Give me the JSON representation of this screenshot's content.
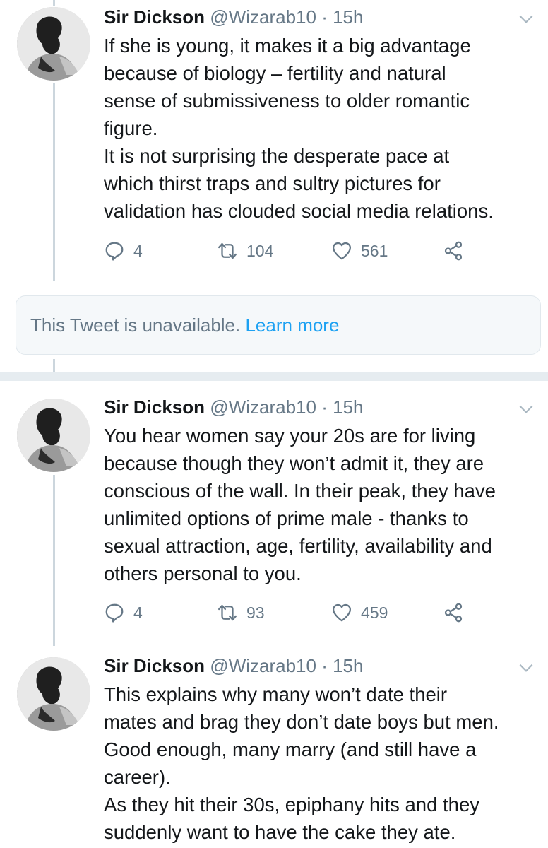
{
  "tweets": [
    {
      "name": "Sir Dickson",
      "handle": "@Wizarab10",
      "dot": " · ",
      "time": "15h",
      "text": "If she is young, it makes it a big advantage\nbecause of biology – fertility and natural\nsense of submissiveness to older romantic\nfigure.\nIt is not surprising the desperate pace at\nwhich thirst traps and sultry pictures for\nvalidation has clouded social media relations.",
      "replies": "4",
      "retweets": "104",
      "likes": "561"
    },
    {
      "name": "Sir Dickson",
      "handle": "@Wizarab10",
      "dot": " · ",
      "time": "15h",
      "text": "You hear women say your 20s are for living\nbecause though they won’t admit it, they are\nconscious of the wall. In their peak, they have\nunlimited options of prime male - thanks to\nsexual attraction, age, fertility, availability and\nothers personal to you.",
      "replies": "4",
      "retweets": "93",
      "likes": "459"
    },
    {
      "name": "Sir Dickson",
      "handle": "@Wizarab10",
      "dot": " · ",
      "time": "15h",
      "text": "This explains why many won’t date their\nmates and brag they don’t date boys but men.\nGood enough, many marry (and still have a\ncareer).\nAs they hit their 30s, epiphany hits and they\nsuddenly want to have the cake they ate."
    }
  ],
  "unavailable": {
    "text": "This Tweet is unavailable. ",
    "link": "Learn more"
  },
  "icons": {
    "reply": "reply-icon",
    "retweet": "retweet-icon",
    "like": "heart-icon",
    "share": "share-icon",
    "menu": "chevron-down-icon"
  },
  "colors": {
    "text": "#14171a",
    "secondary": "#657786",
    "link": "#1da1f2",
    "thread_line": "#ccd6dd",
    "card_bg": "#f5f8fa"
  }
}
